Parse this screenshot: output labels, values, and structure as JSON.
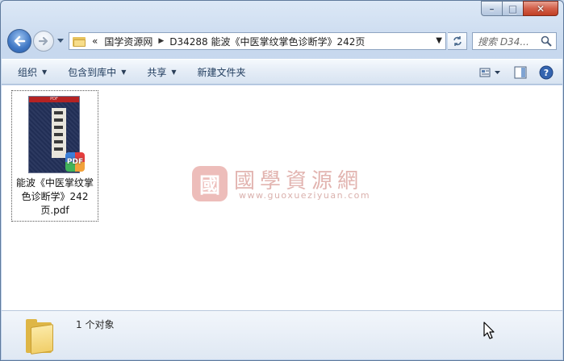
{
  "window": {
    "caption": {
      "minimize": "–",
      "maximize": "□",
      "close": "✕"
    }
  },
  "nav": {
    "back_icon": "back-arrow-icon",
    "forward_icon": "forward-arrow-icon",
    "overflow": "«",
    "breadcrumbs": [
      "国学资源网",
      "D34288 能波《中医掌纹掌色诊断学》242页"
    ],
    "search_placeholder": "搜索 D34..."
  },
  "toolbar": {
    "organize": "组织",
    "include_library": "包含到库中",
    "share": "共享",
    "new_folder": "新建文件夹"
  },
  "file": {
    "name": "能波《中医掌纹掌色诊断学》242页.pdf",
    "thumb_band": "PDF",
    "badge": "PDF"
  },
  "watermark": {
    "seal": "國",
    "title": "國學資源網",
    "url": "www.guoxueziyuan.com"
  },
  "details": {
    "count": "1 个对象"
  },
  "colors": {
    "accent": "#3f77c4",
    "close": "#c13f24",
    "watermark": "#e2b4b0"
  }
}
